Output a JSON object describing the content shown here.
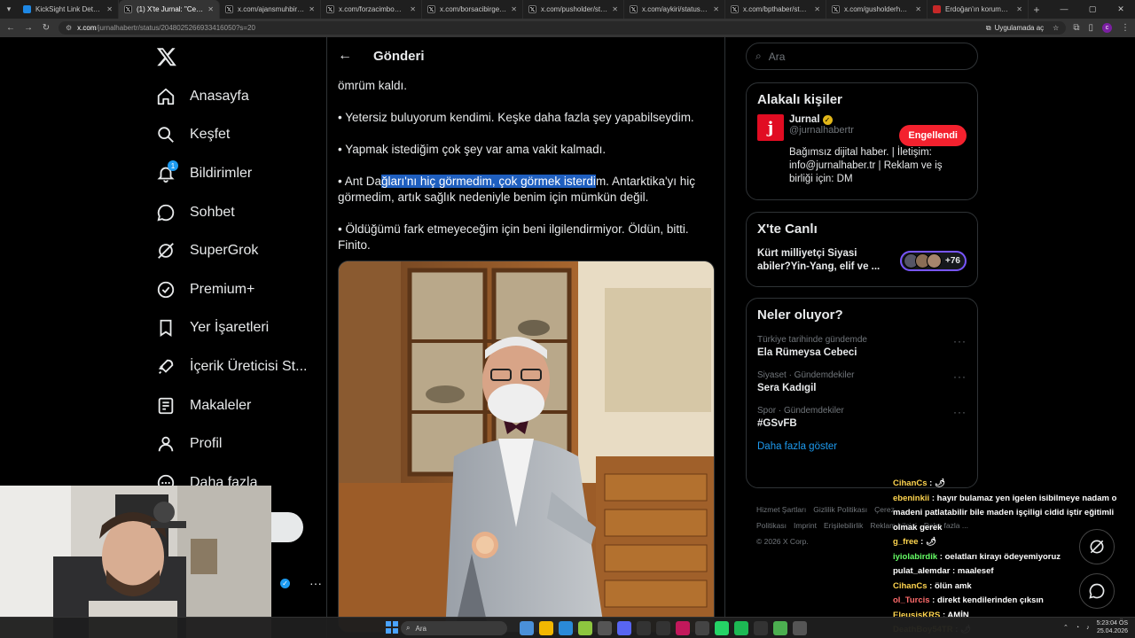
{
  "browser": {
    "tabs": [
      {
        "title": "KickSight Link Detector",
        "icon": "blue"
      },
      {
        "title": "(1) X'te Jurnal: \"Celal Şengör...",
        "icon": "x",
        "active": true
      },
      {
        "title": "x.com/ajansmuhbir1923/status",
        "icon": "x"
      },
      {
        "title": "x.com/forzacimbom/status/20",
        "icon": "x"
      },
      {
        "title": "x.com/borsacibirgenc/status/",
        "icon": "x"
      },
      {
        "title": "x.com/pusholder/status/2047",
        "icon": "x"
      },
      {
        "title": "x.com/aykiri/status/2047749",
        "icon": "x"
      },
      {
        "title": "x.com/bpthaber/status/2048",
        "icon": "x"
      },
      {
        "title": "x.com/gusholderhaber/status",
        "icon": "x"
      },
      {
        "title": "Erdoğan'ın korumaları da var",
        "icon": "red"
      }
    ],
    "url_host": "x.com",
    "url_path": "/jurnalhabertr/status/2048025266933416050?s=20",
    "open_in_app": "Uygulamada aç"
  },
  "nav": {
    "items": [
      {
        "label": "Anasayfa",
        "icon": "home-icon"
      },
      {
        "label": "Keşfet",
        "icon": "search-icon"
      },
      {
        "label": "Bildirimler",
        "icon": "bell-icon",
        "badge": "1"
      },
      {
        "label": "Sohbet",
        "icon": "chat-icon"
      },
      {
        "label": "SuperGrok",
        "icon": "grok-icon"
      },
      {
        "label": "Premium+",
        "icon": "premium-icon"
      },
      {
        "label": "Yer İşaretleri",
        "icon": "bookmark-icon"
      },
      {
        "label": "İçerik Üreticisi St...",
        "icon": "rocket-icon"
      },
      {
        "label": "Makaleler",
        "icon": "articles-icon"
      },
      {
        "label": "Profil",
        "icon": "profile-icon"
      },
      {
        "label": "Daha fazla",
        "icon": "more-icon"
      }
    ]
  },
  "post": {
    "header_title": "Gönderi",
    "line0": "ömrüm kaldı.",
    "line1": "• Yetersiz buluyorum kendimi. Keşke daha fazla şey yapabilseydim.",
    "line2": "• Yapmak istediğim çok şey var ama vakit kalmadı.",
    "line3_pre": "• Ant Da",
    "line3_highlight": "ğları'nı hiç görmedim, çok görmek isterdi",
    "line3_post": "m. Antarktika'yı hiç görmedim, artık sağlık nedeniyle benim için mümkün değil.",
    "line4": "• Öldüğümü fark etmeyeceğim için beni ilgilendirmiyor. Öldün, bitti. Finito."
  },
  "right": {
    "search_placeholder": "Ara",
    "related": {
      "title": "Alakalı kişiler",
      "name": "Jurnal",
      "handle": "@jurnalhabertr",
      "button": "Engellendi",
      "bio": "Bağımsız dijital haber. | İletişim: info@jurnalhaber.tr | Reklam ve iş birliği için: DM"
    },
    "live": {
      "title": "X'te Canlı",
      "text": "Kürt milliyetçi Siyasi abiler?Yin-Yang, elif ve ...",
      "count": "+76"
    },
    "trends": {
      "title": "Neler oluyor?",
      "items": [
        {
          "meta": "Türkiye tarihinde gündemde",
          "name": "Ela Rümeysa Cebeci"
        },
        {
          "meta": "Siyaset · Gündemdekiler",
          "name": "Sera Kadıgil"
        },
        {
          "meta": "Spor · Gündemdekiler",
          "name": "#GSvFB"
        }
      ],
      "more": "Daha fazla göster"
    },
    "footer": {
      "links": [
        "Hizmet Şartları",
        "Gizlilik Politikası",
        "Çerez Politikası",
        "Imprint",
        "Erişilebilirlik",
        "Reklam bilgisi",
        "Daha fazla ..."
      ],
      "copyright": "© 2026 X Corp."
    }
  },
  "chat": [
    {
      "user": "CihanCs",
      "color": "#ffd54f",
      "text": "🌶"
    },
    {
      "user": "ebeninkii",
      "color": "#ffd54f",
      "text": "hayır bulamaz yen igelen isibilmeye nadam o madeni patlatabilir bile maden işçiligi cidid iştir eğitimli olmak gerek"
    },
    {
      "user": "g_free",
      "color": "#ffd54f",
      "text": "🌶"
    },
    {
      "user": "iyiolabirdik",
      "color": "#66ff66",
      "text": "oelatları kirayı ödeyemiyoruz"
    },
    {
      "user": "pulat_alemdar",
      "color": "#ffffff",
      "text": "maalesef"
    },
    {
      "user": "CihanCs",
      "color": "#ffd54f",
      "text": "ölün amk"
    },
    {
      "user": "ol_Turcis",
      "color": "#ff6b6b",
      "text": "direkt kendilerinden çıksın"
    },
    {
      "user": "EleusisKRS",
      "color": "#ffd54f",
      "text": "AMİN"
    },
    {
      "user": "DeathBoy54TR",
      "color": "#ffd54f",
      "text": "🌶"
    }
  ],
  "taskbar": {
    "search": "Ara",
    "time": "5:23:04 ÖS",
    "date": "25.04.2026"
  }
}
